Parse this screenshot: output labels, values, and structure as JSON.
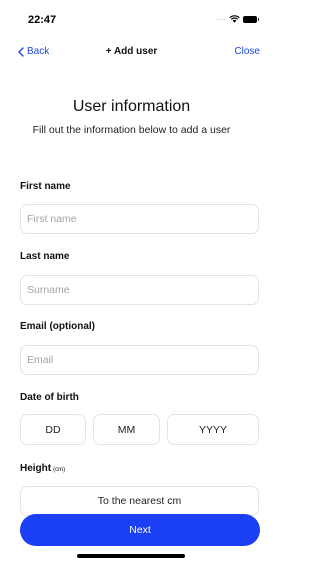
{
  "status_bar": {
    "time": "22:47",
    "signal_dots": "...."
  },
  "nav": {
    "back_label": "Back",
    "title": "+ Add user",
    "close_label": "Close"
  },
  "header": {
    "title": "User information",
    "subtitle": "Fill out the information below to add a user"
  },
  "form": {
    "first_name": {
      "label": "First name",
      "placeholder": "First name",
      "value": ""
    },
    "last_name": {
      "label": "Last name",
      "placeholder": "Surname",
      "value": ""
    },
    "email": {
      "label": "Email (optional)",
      "placeholder": "Email",
      "value": ""
    },
    "dob": {
      "label": "Date of birth",
      "day": "DD",
      "month": "MM",
      "year": "YYYY"
    },
    "height": {
      "label": "Height",
      "unit": "(cm)",
      "placeholder": "To the nearest cm"
    }
  },
  "actions": {
    "next_label": "Next"
  },
  "colors": {
    "accent": "#1a47e5",
    "button": "#1a3ff5"
  }
}
